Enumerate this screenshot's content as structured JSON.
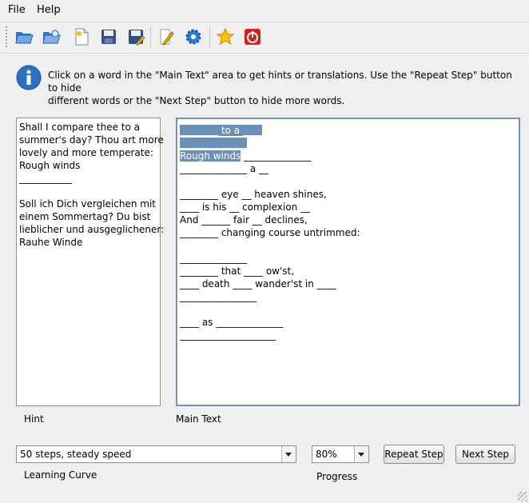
{
  "menu": {
    "file": "File",
    "help": "Help"
  },
  "toolbar": {
    "buttons": [
      {
        "icon": "open-folder-icon"
      },
      {
        "icon": "open-remote-icon"
      },
      {
        "icon": "new-document-icon"
      },
      {
        "icon": "save-icon"
      },
      {
        "icon": "save-as-icon"
      },
      {
        "icon": "edit-icon"
      },
      {
        "icon": "settings-gear-icon"
      },
      {
        "icon": "favorite-star-icon"
      },
      {
        "icon": "quit-icon"
      }
    ]
  },
  "info": {
    "line1": "Click on a word in the \"Main Text\" area to get hints or translations. Use the \"Repeat Step\" button to hide",
    "line2": "different words or the \"Next Step\" button to hide more words."
  },
  "hint": {
    "label": "Hint",
    "lines": [
      "Shall I compare thee to a",
      "summer's day? Thou art more",
      "lovely and more temperate:",
      "Rough winds",
      "___________",
      "",
      "Soll ich Dich vergleichen mit",
      "einem Sommertag? Du bist",
      "lieblicher und ausgeglichener:",
      "Rauhe Winde"
    ]
  },
  "main": {
    "label": "Main Text",
    "hl_line1_a": "________ to a ____",
    "hl_line2": "______________",
    "hl_line3": "Rough winds",
    "line3_rest": " ______________",
    "lines": [
      "______________ a __",
      "",
      "________ eye __ heaven shines,",
      "____ is his __ complexion __",
      "And ______ fair __ declines,",
      "________ changing course untrimmed:",
      "",
      "______________",
      "________ that ____ ow'st,",
      "____ death ____ wander'st in ____",
      "________________",
      "",
      "____ as ______________",
      "____________________"
    ]
  },
  "controls": {
    "curve_value": "50 steps, steady speed",
    "curve_label": "Learning Curve",
    "progress_value": "80%",
    "progress_label": "Progress",
    "repeat_label": "Repeat Step",
    "next_label": "Next Step"
  }
}
